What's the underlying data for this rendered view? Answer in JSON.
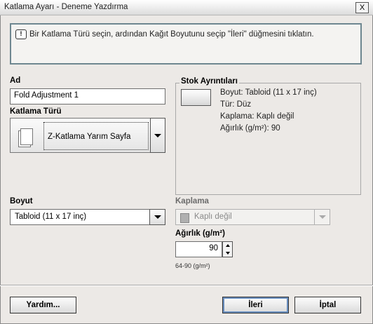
{
  "window": {
    "title": "Katlama Ayarı - Deneme Yazdırma",
    "close_label": "X"
  },
  "info": {
    "message": "Bir Katlama Türü seçin, ardından Kağıt Boyutunu seçip \"İleri\" düğmesini tıklatın.",
    "icon": "speech-bubble-exclamation-icon"
  },
  "name": {
    "label": "Ad",
    "value": "Fold Adjustment 1"
  },
  "fold_type": {
    "label": "Katlama Türü",
    "selected": "Z-Katlama Yarım Sayfa"
  },
  "stock": {
    "label": "Stok Ayrıntıları",
    "size": "Boyut: Tabloid (11 x 17 inç)",
    "type": "Tür: Düz",
    "coating": "Kaplama: Kaplı değil",
    "weight": "Ağırlık (g/m²): 90"
  },
  "size": {
    "label": "Boyut",
    "selected": "Tabloid (11 x 17 inç)"
  },
  "coating": {
    "label": "Kaplama",
    "selected": "Kaplı değil",
    "enabled": false
  },
  "weight": {
    "label": "Ağırlık (g/m²)",
    "value": "90",
    "range": "64-90 (g/m²)"
  },
  "buttons": {
    "help": "Yardım...",
    "next": "İleri",
    "cancel": "İptal"
  }
}
